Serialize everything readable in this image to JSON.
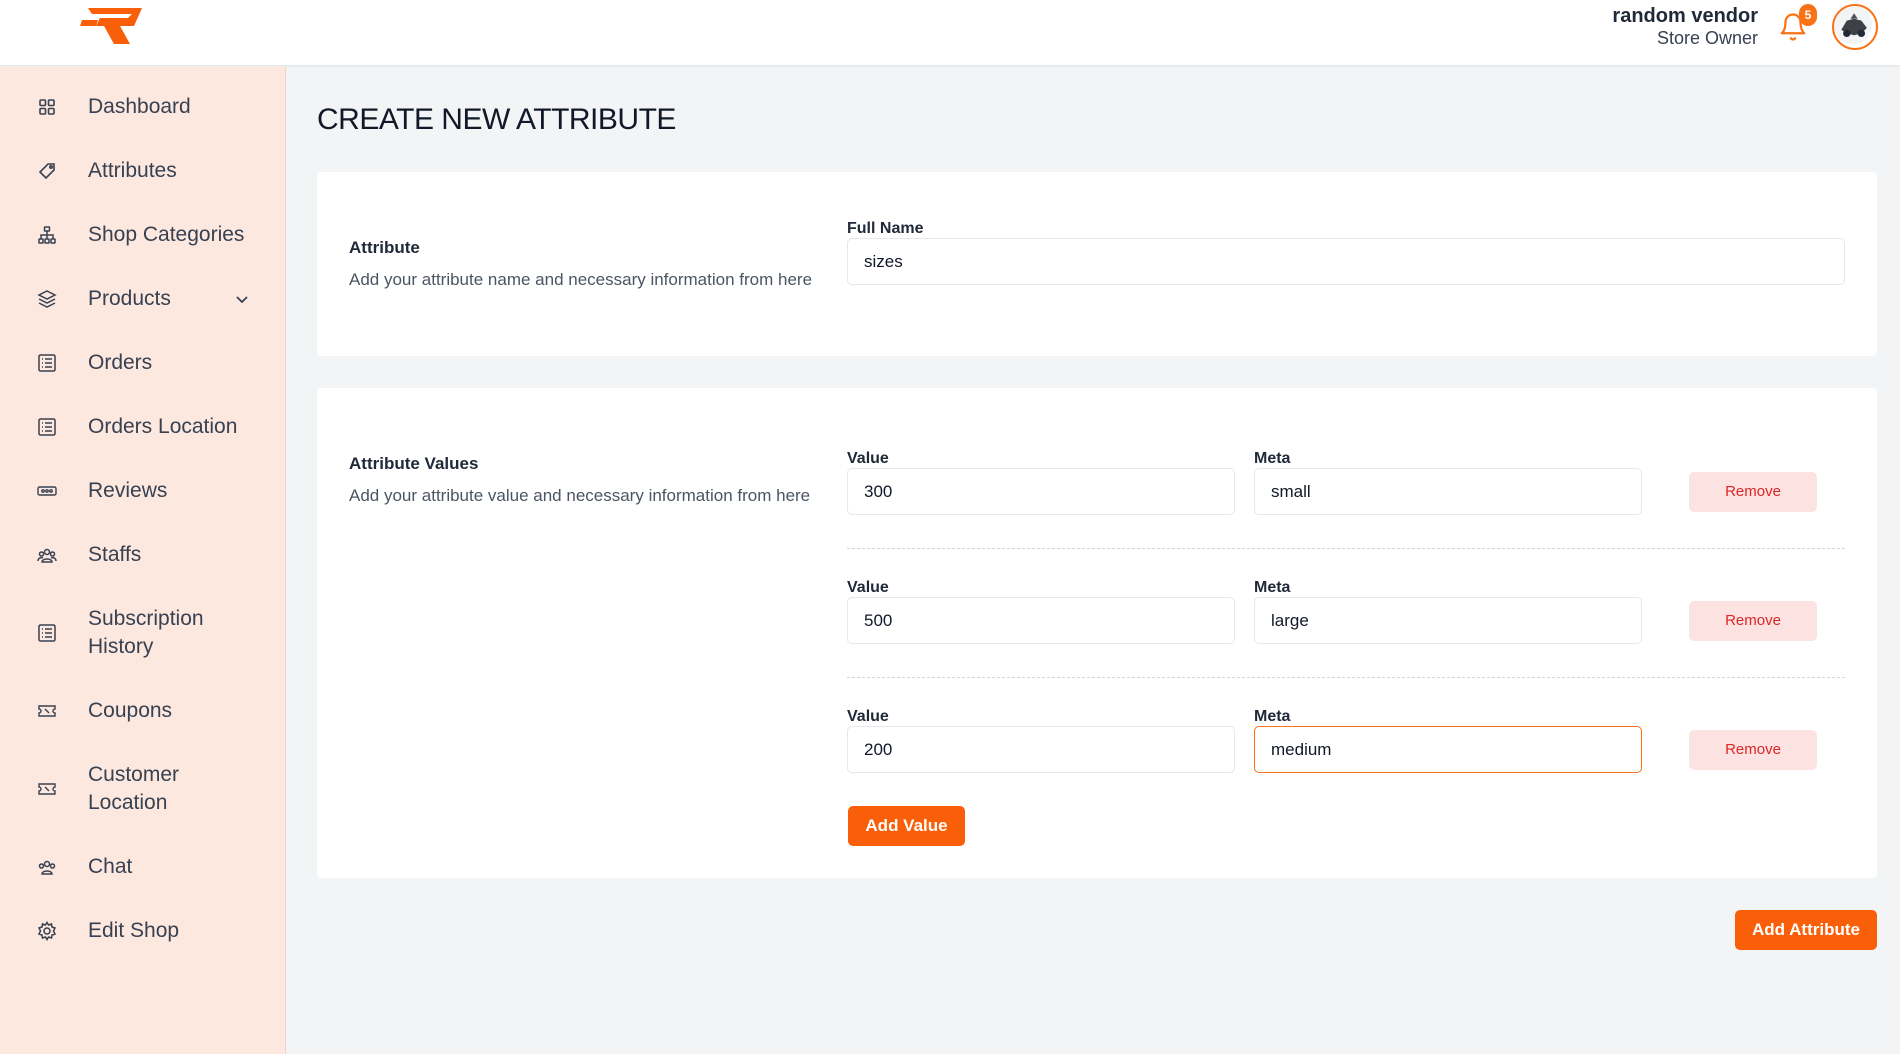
{
  "header": {
    "user_name": "random vendor",
    "user_role": "Store Owner",
    "notification_count": "5",
    "brand_color": "#f97316"
  },
  "sidebar": {
    "items": [
      {
        "label": "Dashboard",
        "icon": "grid-icon"
      },
      {
        "label": "Attributes",
        "icon": "tag-icon"
      },
      {
        "label": "Shop Categories",
        "icon": "hierarchy-icon"
      },
      {
        "label": "Products",
        "icon": "box-icon"
      },
      {
        "label": "Orders",
        "icon": "list-icon"
      },
      {
        "label": "Orders Location",
        "icon": "list-icon"
      },
      {
        "label": "Reviews",
        "icon": "rating-icon"
      },
      {
        "label": "Staffs",
        "icon": "users-icon"
      },
      {
        "label": "Subscription History",
        "icon": "list-icon"
      },
      {
        "label": "Coupons",
        "icon": "coupon-icon"
      },
      {
        "label": "Customer Location",
        "icon": "coupon-icon"
      },
      {
        "label": "Chat",
        "icon": "users-icon"
      },
      {
        "label": "Edit Shop",
        "icon": "gear-icon"
      }
    ]
  },
  "main": {
    "page_title": "CREATE NEW ATTRIBUTE",
    "attribute_card": {
      "title": "Attribute",
      "description": "Add your attribute name and necessary information from here",
      "full_name_label": "Full Name",
      "full_name_value": "sizes"
    },
    "values_card": {
      "title": "Attribute Values",
      "description": "Add your attribute value and necessary information from here",
      "value_label": "Value",
      "meta_label": "Meta",
      "remove_label": "Remove",
      "rows": [
        {
          "value": "300",
          "meta": "small"
        },
        {
          "value": "500",
          "meta": "large"
        },
        {
          "value": "200",
          "meta": "medium"
        }
      ],
      "add_value_label": "Add Value"
    },
    "submit_label": "Add Attribute"
  }
}
